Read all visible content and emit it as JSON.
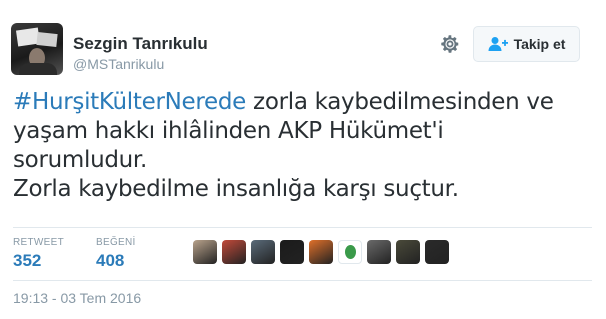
{
  "user": {
    "name": "Sezgin Tanrıkulu",
    "handle": "@MSTanrikulu"
  },
  "actions": {
    "follow_label": "Takip et"
  },
  "tweet": {
    "hashtag": "#HurşitKülterNerede",
    "line1_rest": " zorla kaybedilmesinden ve",
    "line2": "yaşam hakkı ihlâlinden AKP Hükümet'i",
    "line3": "sorumludur.",
    "line4": "Zorla kaybedilme insanlığa karşı suçtur."
  },
  "stats": {
    "retweet_label": "RETWEET",
    "retweet_count": "352",
    "like_label": "BEĞENİ",
    "like_count": "408"
  },
  "likers": [
    {
      "color": "#b9a38c"
    },
    {
      "color": "#c24a3a"
    },
    {
      "color": "#5a6b7a"
    },
    {
      "color": "#1b1b1b"
    },
    {
      "color": "#e0702a"
    },
    {
      "color": "#3a9a4a"
    },
    {
      "color": "#6a6a6a"
    },
    {
      "color": "#4a4a3a"
    },
    {
      "color": "#2a2a2a"
    }
  ],
  "timestamp": "19:13 - 03 Tem 2016",
  "colors": {
    "link": "#2b7bb9",
    "muted": "#8899a6",
    "text": "#292f33"
  }
}
